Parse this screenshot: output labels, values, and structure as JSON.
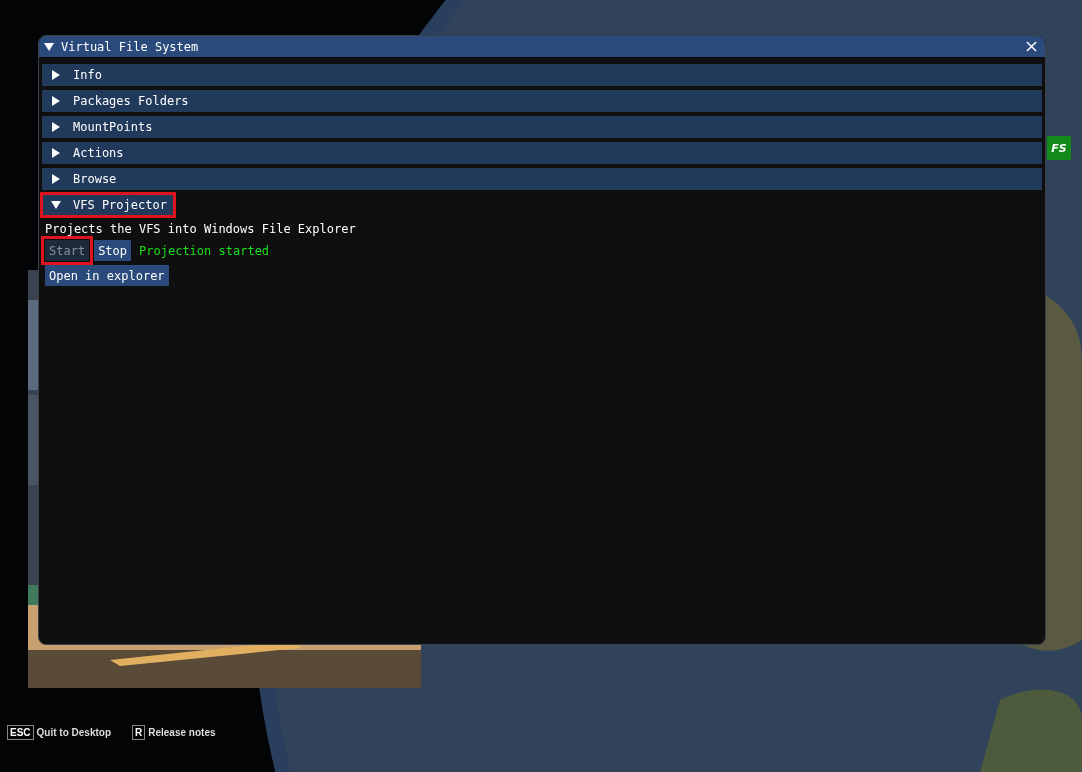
{
  "window": {
    "title": "Virtual File System",
    "expanded": true
  },
  "sections": [
    {
      "label": "Info",
      "expanded": false,
      "highlighted": false
    },
    {
      "label": "Packages Folders",
      "expanded": false,
      "highlighted": false
    },
    {
      "label": "MountPoints",
      "expanded": false,
      "highlighted": false
    },
    {
      "label": "Actions",
      "expanded": false,
      "highlighted": false
    },
    {
      "label": "Browse",
      "expanded": false,
      "highlighted": false
    },
    {
      "label": "VFS Projector",
      "expanded": true,
      "highlighted": true
    }
  ],
  "projector": {
    "description": "Projects the VFS into Windows File Explorer",
    "buttons": [
      {
        "label": "Start",
        "disabled": true,
        "highlighted": true
      },
      {
        "label": "Stop",
        "disabled": false,
        "highlighted": false
      }
    ],
    "status": "Projection started",
    "open_button": {
      "label": "Open in explorer",
      "disabled": false,
      "highlighted": false
    }
  },
  "store_badge": {
    "label": "FS"
  },
  "hints": [
    {
      "key": "ESC",
      "label": "Quit to Desktop"
    },
    {
      "key": "R",
      "label": "Release notes"
    }
  ]
}
